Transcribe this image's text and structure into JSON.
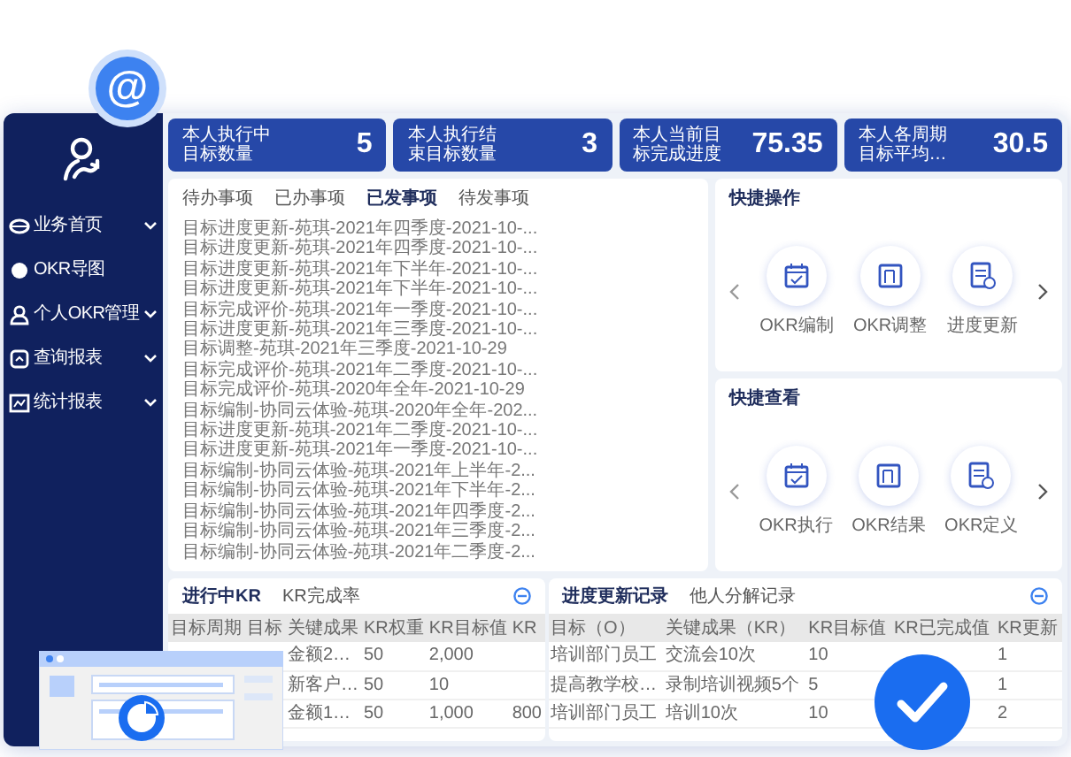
{
  "badge": {
    "symbol": "@"
  },
  "sidebar": {
    "items": [
      {
        "label": "业务首页",
        "expandable": true
      },
      {
        "label": "OKR导图",
        "expandable": false
      },
      {
        "label": "个人OKR管理",
        "expandable": true
      },
      {
        "label": "查询报表",
        "expandable": true
      },
      {
        "label": "统计报表",
        "expandable": true
      }
    ]
  },
  "stats": [
    {
      "label": "本人执行中目标数量",
      "value": "5"
    },
    {
      "label": "本人执行结束目标数量",
      "value": "3"
    },
    {
      "label": "本人当前目标完成进度",
      "value": "75.35"
    },
    {
      "label": "本人各周期目标平均…",
      "value": "30.5"
    }
  ],
  "messages": {
    "tabs": [
      {
        "label": "待办事项",
        "selected": false
      },
      {
        "label": "已办事项",
        "selected": false
      },
      {
        "label": "已发事项",
        "selected": true
      },
      {
        "label": "待发事项",
        "selected": false
      }
    ],
    "items": [
      "目标进度更新-苑琪-2021年四季度-2021-10-...",
      "目标进度更新-苑琪-2021年四季度-2021-10-...",
      "目标进度更新-苑琪-2021年下半年-2021-10-...",
      "目标进度更新-苑琪-2021年下半年-2021-10-...",
      "目标完成评价-苑琪-2021年一季度-2021-10-...",
      "目标进度更新-苑琪-2021年三季度-2021-10-...",
      "目标调整-苑琪-2021年三季度-2021-10-29",
      "目标完成评价-苑琪-2021年二季度-2021-10-...",
      "目标完成评价-苑琪-2020年全年-2021-10-29",
      "目标编制-协同云体验-苑琪-2020年全年-202...",
      "目标进度更新-苑琪-2021年二季度-2021-10-...",
      "目标进度更新-苑琪-2021年一季度-2021-10-...",
      "目标编制-协同云体验-苑琪-2021年上半年-2...",
      "目标编制-协同云体验-苑琪-2021年下半年-2...",
      "目标编制-协同云体验-苑琪-2021年四季度-2...",
      "目标编制-协同云体验-苑琪-2021年三季度-2...",
      "目标编制-协同云体验-苑琪-2021年二季度-2..."
    ]
  },
  "quick_panels": [
    {
      "title": "快捷操作",
      "actions": [
        "OKR编制",
        "OKR调整",
        "进度更新"
      ]
    },
    {
      "title": "快捷查看",
      "actions": [
        "OKR执行",
        "OKR结果",
        "OKR定义"
      ]
    }
  ],
  "tables": [
    {
      "tabs": [
        {
          "label": "进行中KR",
          "selected": true
        },
        {
          "label": "KR完成率",
          "selected": false
        }
      ],
      "columns": [
        "目标周期",
        "目标",
        "关键成果",
        "KR权重",
        "KR目标值",
        "KR"
      ],
      "rows": [
        [
          "",
          "",
          "金额2…",
          "50",
          "2,000",
          ""
        ],
        [
          "",
          "",
          "新客户…",
          "50",
          "10",
          ""
        ],
        [
          "",
          "",
          "金额1…",
          "50",
          "1,000",
          "800"
        ]
      ]
    },
    {
      "tabs": [
        {
          "label": "进度更新记录",
          "selected": true
        },
        {
          "label": "他人分解记录",
          "selected": false
        }
      ],
      "columns": [
        "目标（O）",
        "关键成果（KR）",
        "KR目标值",
        "KR已完成值",
        "KR更新"
      ],
      "rows": [
        [
          "培训部门员工",
          "交流会10次",
          "10",
          "",
          "1"
        ],
        [
          "提高教学校…",
          "录制培训视频5个",
          "5",
          "",
          "1"
        ],
        [
          "培训部门员工",
          "培训10次",
          "10",
          "",
          "2"
        ]
      ]
    }
  ]
}
